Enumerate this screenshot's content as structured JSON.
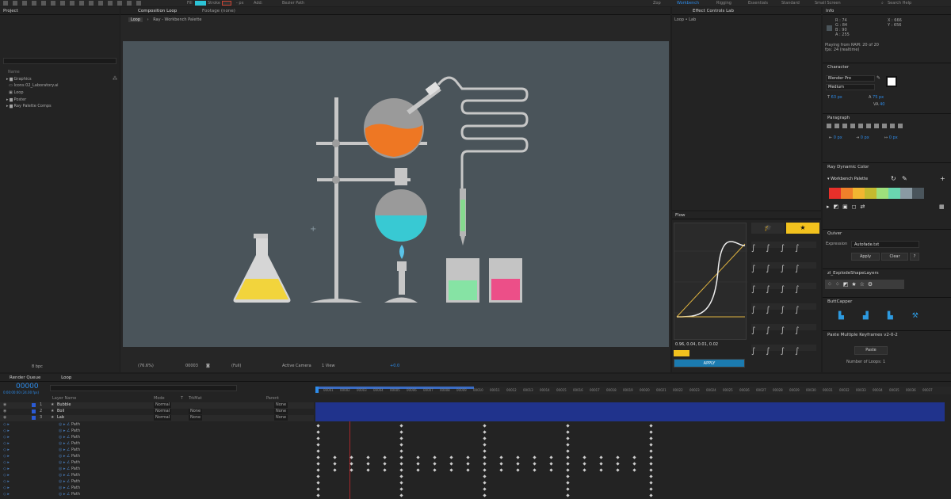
{
  "toolbar": {
    "fill": "Fill",
    "stroke": "Stroke",
    "px": "- px",
    "add": "Add:",
    "bezier": "Bezier Path",
    "search": "Search Help",
    "workspaces": [
      "Zop",
      "Workbench",
      "Rigging",
      "Essentials",
      "Standard",
      "Small Screen"
    ]
  },
  "project": {
    "title": "Project",
    "items": [
      "Graphics",
      "Icons 02_Laboratory.ai",
      "Loop",
      "Poster",
      "Ray Palette Comps"
    ],
    "col_name": "Name",
    "bpc": "8 bpc"
  },
  "comp": {
    "tab": "Composition Loop",
    "footage_tab": "Footage (none)",
    "crumb_loop": "Loop",
    "crumb_palette": "Ray - Workbench Palette",
    "zoom": "(76.6%)",
    "time": "00003",
    "res": "(Full)",
    "camera": "Active Camera",
    "view": "1 View",
    "offset": "+0.0"
  },
  "effect": {
    "tab": "Effect Controls Lab",
    "sub": "Loop • Lab"
  },
  "info": {
    "title": "Info",
    "r": "R : 74",
    "g": "G : 84",
    "b": "B : 90",
    "a": "A : 255",
    "x": "X : 666",
    "y": "Y : 656",
    "playing": "Playing from RAM: 20 of 20",
    "fps": "fps: 24 (realtime)"
  },
  "character": {
    "title": "Character",
    "font": "Blender Pro",
    "style": "Medium",
    "size": "63 px",
    "leading": "75 px",
    "tracking": "40"
  },
  "paragraph": {
    "title": "Paragraph",
    "indent": "0 px"
  },
  "rdc": {
    "title": "Ray Dynamic Color",
    "palette": "Workbench Palette",
    "swatches": [
      "#e8302a",
      "#f0802a",
      "#f2b631",
      "#c4ba2f",
      "#9ee07c",
      "#6ad6b0",
      "#8a9aa3",
      "#4a555c"
    ]
  },
  "quiver": {
    "title": "Quiver",
    "label": "Expression",
    "value": "Autofade.txt",
    "apply": "Apply",
    "clear": "Clear",
    "help": "?"
  },
  "explode": {
    "title": "zl_ExplodeShapeLayers"
  },
  "buttcapper": {
    "title": "ButtCapper"
  },
  "pmk": {
    "title": "Paste Multiple Keyframes v2-0-2",
    "paste": "Paste",
    "loops_label": "Number of Loops:",
    "loops": "1"
  },
  "flow": {
    "title": "Flow",
    "values": "0.96, 0.04, 0.01, 0.02",
    "apply": "APPLY"
  },
  "timeline": {
    "render_tab": "Render Queue",
    "loop_tab": "Loop",
    "timecode": "00000",
    "tc_sub": "0:00:00:00 (24.00 fps)",
    "cols": [
      "Layer Name",
      "Mode",
      "T",
      "TrkMat",
      "Parent"
    ],
    "layers": [
      {
        "num": "1",
        "name": "Bubble",
        "mode": "Normal",
        "trk": "",
        "parent": "None"
      },
      {
        "num": "2",
        "name": "Boil",
        "mode": "Normal",
        "trk": "None",
        "parent": "None"
      },
      {
        "num": "3",
        "name": "Lab",
        "mode": "Normal",
        "trk": "None",
        "parent": "None"
      }
    ],
    "path_label": "Path",
    "frames": [
      "00001",
      "00002",
      "00003",
      "00004",
      "00005",
      "00006",
      "00007",
      "00008",
      "00009",
      "00010",
      "00011",
      "00012",
      "00013",
      "00014",
      "00015",
      "00016",
      "00017",
      "00018",
      "00019",
      "00020",
      "00021",
      "00022",
      "00023",
      "00024",
      "00025",
      "00026",
      "00027",
      "00028",
      "00029",
      "00030",
      "00031",
      "00032",
      "00033",
      "00034",
      "00035",
      "00036",
      "00037"
    ]
  }
}
